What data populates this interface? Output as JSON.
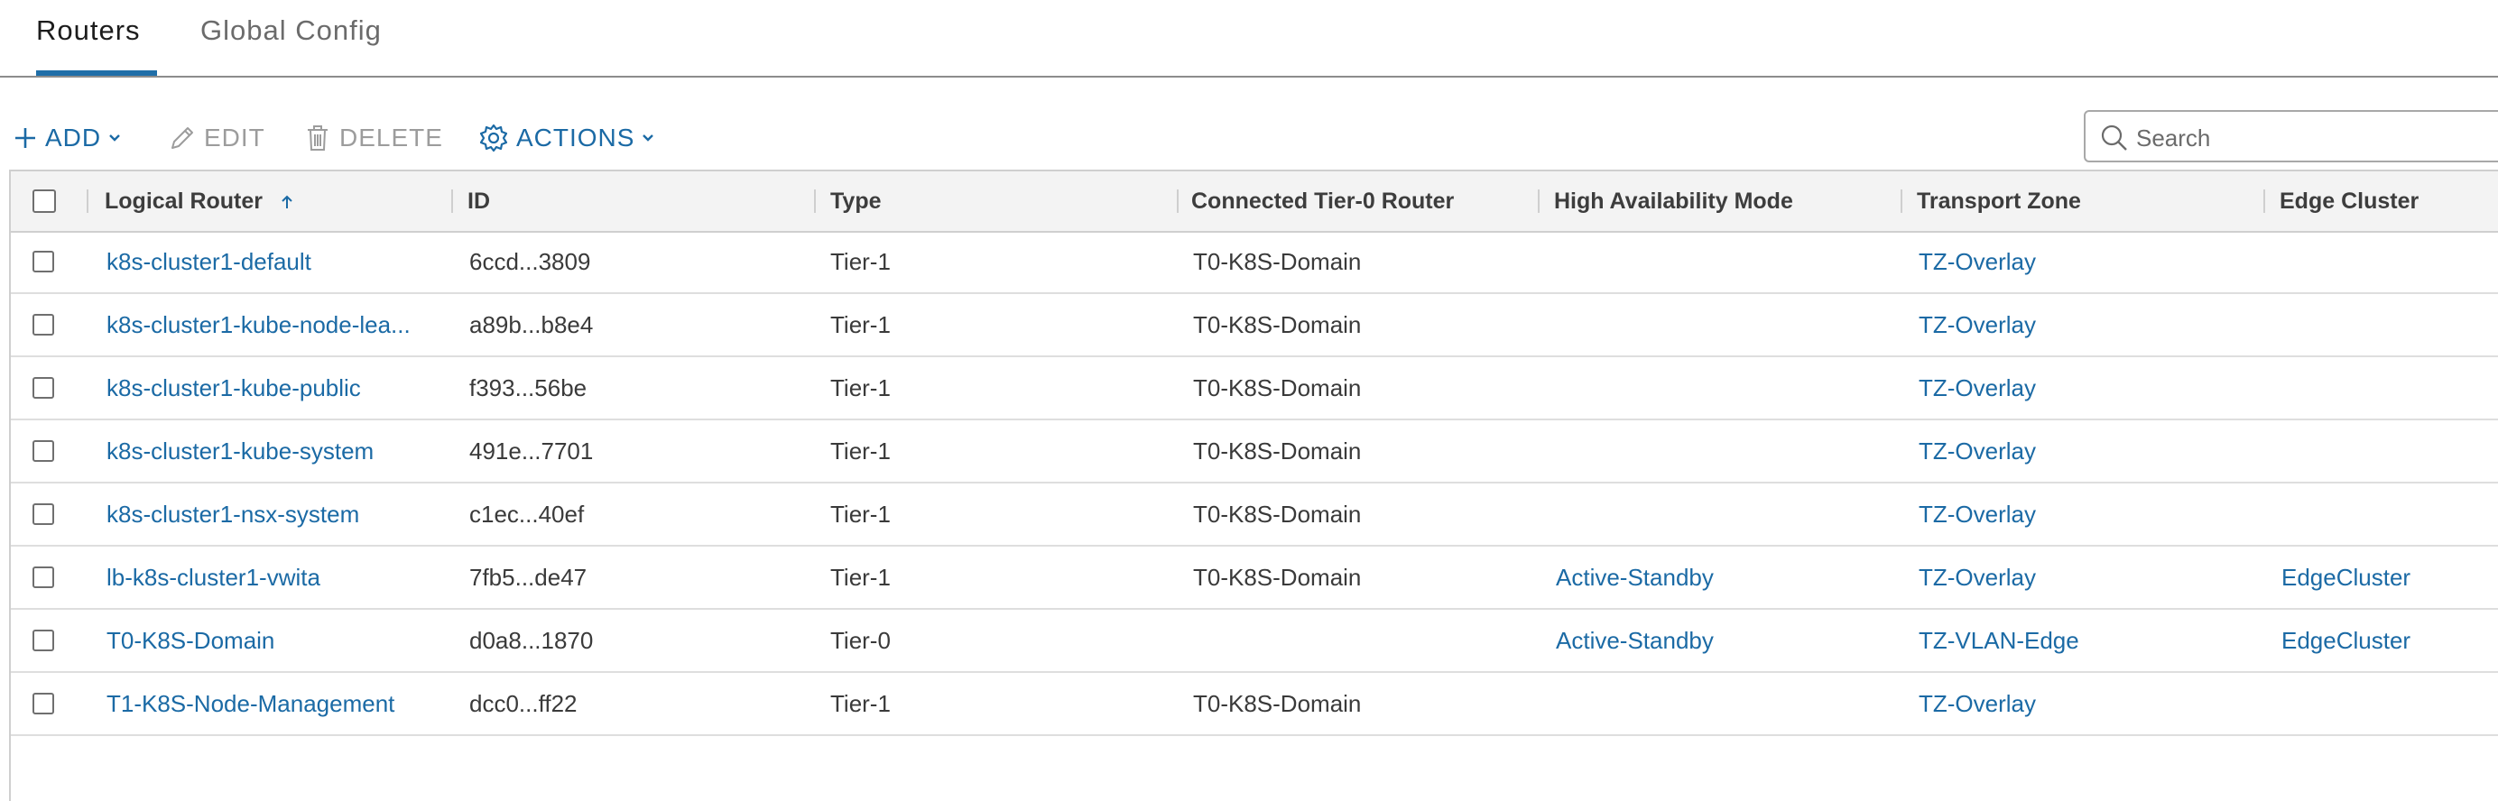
{
  "tabs": [
    {
      "label": "Routers",
      "active": true
    },
    {
      "label": "Global Config",
      "active": false
    }
  ],
  "toolbar": {
    "add_label": "ADD",
    "edit_label": "EDIT",
    "delete_label": "DELETE",
    "actions_label": "ACTIONS",
    "search_placeholder": "Search"
  },
  "table": {
    "columns": [
      "Logical Router",
      "ID",
      "Type",
      "Connected Tier-0 Router",
      "High Availability Mode",
      "Transport Zone",
      "Edge Cluster"
    ],
    "sort": {
      "column": "Logical Router",
      "direction": "ascending"
    },
    "rows": [
      {
        "name": "k8s-cluster1-default",
        "id": "6ccd...3809",
        "type": "Tier-1",
        "tier0": "T0-K8S-Domain",
        "ha": "",
        "tz": "TZ-Overlay",
        "edge": ""
      },
      {
        "name": "k8s-cluster1-kube-node-lea...",
        "id": "a89b...b8e4",
        "type": "Tier-1",
        "tier0": "T0-K8S-Domain",
        "ha": "",
        "tz": "TZ-Overlay",
        "edge": ""
      },
      {
        "name": "k8s-cluster1-kube-public",
        "id": "f393...56be",
        "type": "Tier-1",
        "tier0": "T0-K8S-Domain",
        "ha": "",
        "tz": "TZ-Overlay",
        "edge": ""
      },
      {
        "name": "k8s-cluster1-kube-system",
        "id": "491e...7701",
        "type": "Tier-1",
        "tier0": "T0-K8S-Domain",
        "ha": "",
        "tz": "TZ-Overlay",
        "edge": ""
      },
      {
        "name": "k8s-cluster1-nsx-system",
        "id": "c1ec...40ef",
        "type": "Tier-1",
        "tier0": "T0-K8S-Domain",
        "ha": "",
        "tz": "TZ-Overlay",
        "edge": ""
      },
      {
        "name": "lb-k8s-cluster1-vwita",
        "id": "7fb5...de47",
        "type": "Tier-1",
        "tier0": "T0-K8S-Domain",
        "ha": "Active-Standby",
        "tz": "TZ-Overlay",
        "edge": "EdgeCluster"
      },
      {
        "name": "T0-K8S-Domain",
        "id": "d0a8...1870",
        "type": "Tier-0",
        "tier0": "",
        "ha": "Active-Standby",
        "tz": "TZ-VLAN-Edge",
        "edge": "EdgeCluster"
      },
      {
        "name": "T1-K8S-Node-Management",
        "id": "dcc0...ff22",
        "type": "Tier-1",
        "tier0": "T0-K8S-Domain",
        "ha": "",
        "tz": "TZ-Overlay",
        "edge": ""
      }
    ]
  },
  "colors": {
    "link": "#1b6aa5",
    "tab_underline": "#1f6ea8",
    "disabled": "#9c9c9c"
  }
}
